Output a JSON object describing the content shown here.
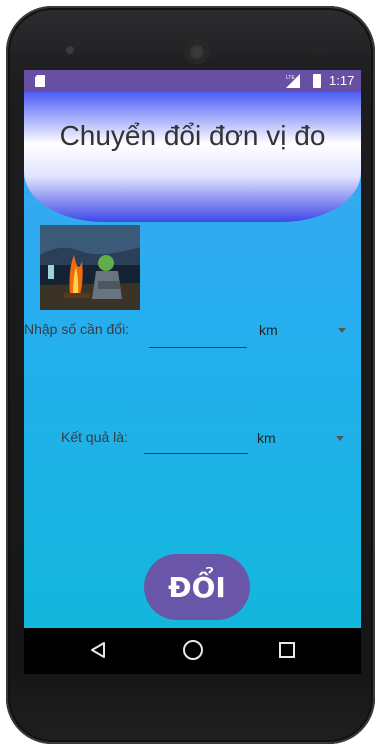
{
  "status_bar": {
    "time": "1:17",
    "network": "LTE"
  },
  "app": {
    "title": "Chuyển đổi đơn vị đo",
    "input_label": "Nhập số cần đổi:",
    "input_value": "",
    "input_unit": "km",
    "result_label": "Kết quả là:",
    "result_value": "",
    "result_unit": "km",
    "convert_button": "ĐỔI"
  },
  "nav_bar": {
    "items": [
      "back-icon",
      "home-icon",
      "recents-icon"
    ]
  },
  "colors": {
    "status_bar": "#6750a4",
    "button": "#6a56a8",
    "background_top": "#41a5ef",
    "background_bottom": "#13b7dc"
  }
}
